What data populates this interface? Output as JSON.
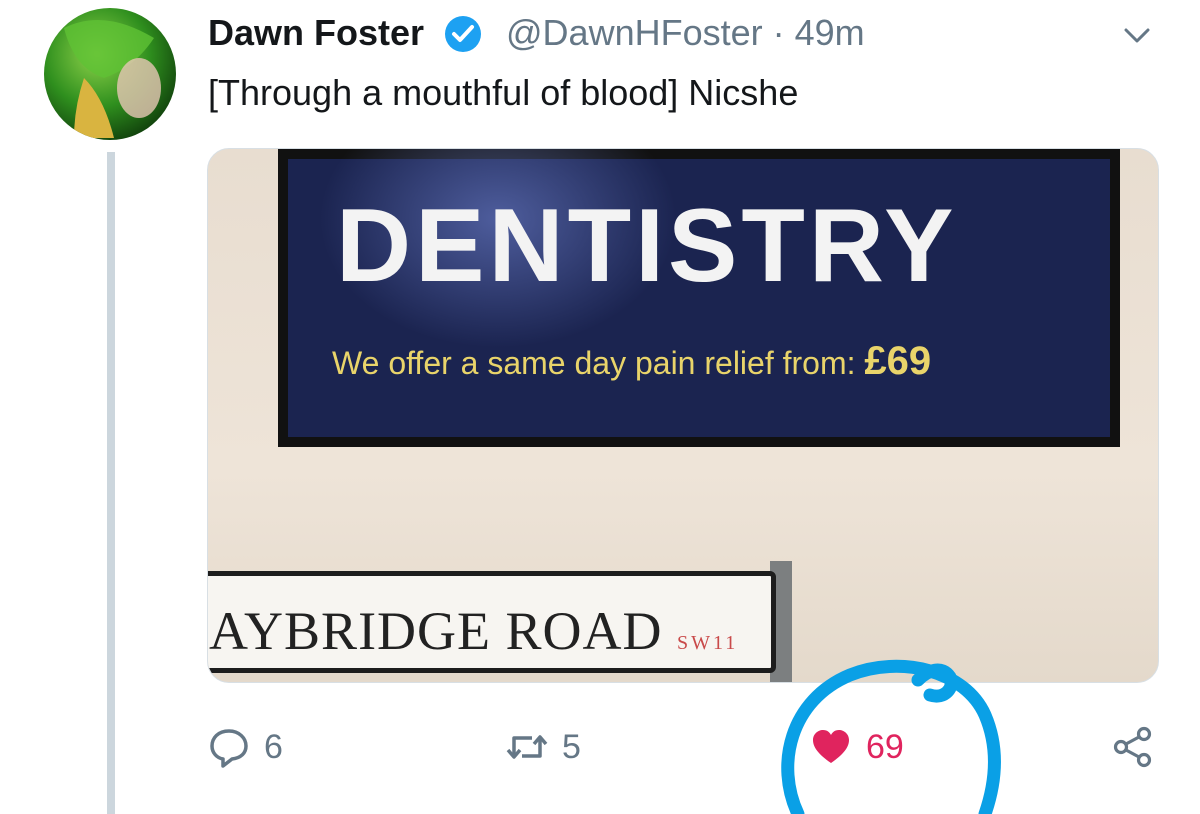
{
  "tweet": {
    "name": "Dawn Foster",
    "handle_time": "@DawnHFoster · 49m",
    "text": "[Through a mouthful of blood] Nicshe"
  },
  "photo": {
    "sign_title": "DENTISTRY",
    "sign_subtitle": "We offer a same day pain relief from:",
    "sign_price": "£69",
    "road_name": "AYBRIDGE ROAD",
    "road_postcode": "SW11"
  },
  "actions": {
    "replies": "6",
    "retweets": "5",
    "likes": "69"
  },
  "colors": {
    "text": "#14171a",
    "secondary": "#657786",
    "verified": "#1da1f2",
    "like": "#e0245e",
    "annotation": "#0aa0e6"
  },
  "icons": [
    "verified-badge-icon",
    "chevron-down-icon",
    "reply-icon",
    "retweet-icon",
    "heart-icon",
    "share-icon"
  ]
}
